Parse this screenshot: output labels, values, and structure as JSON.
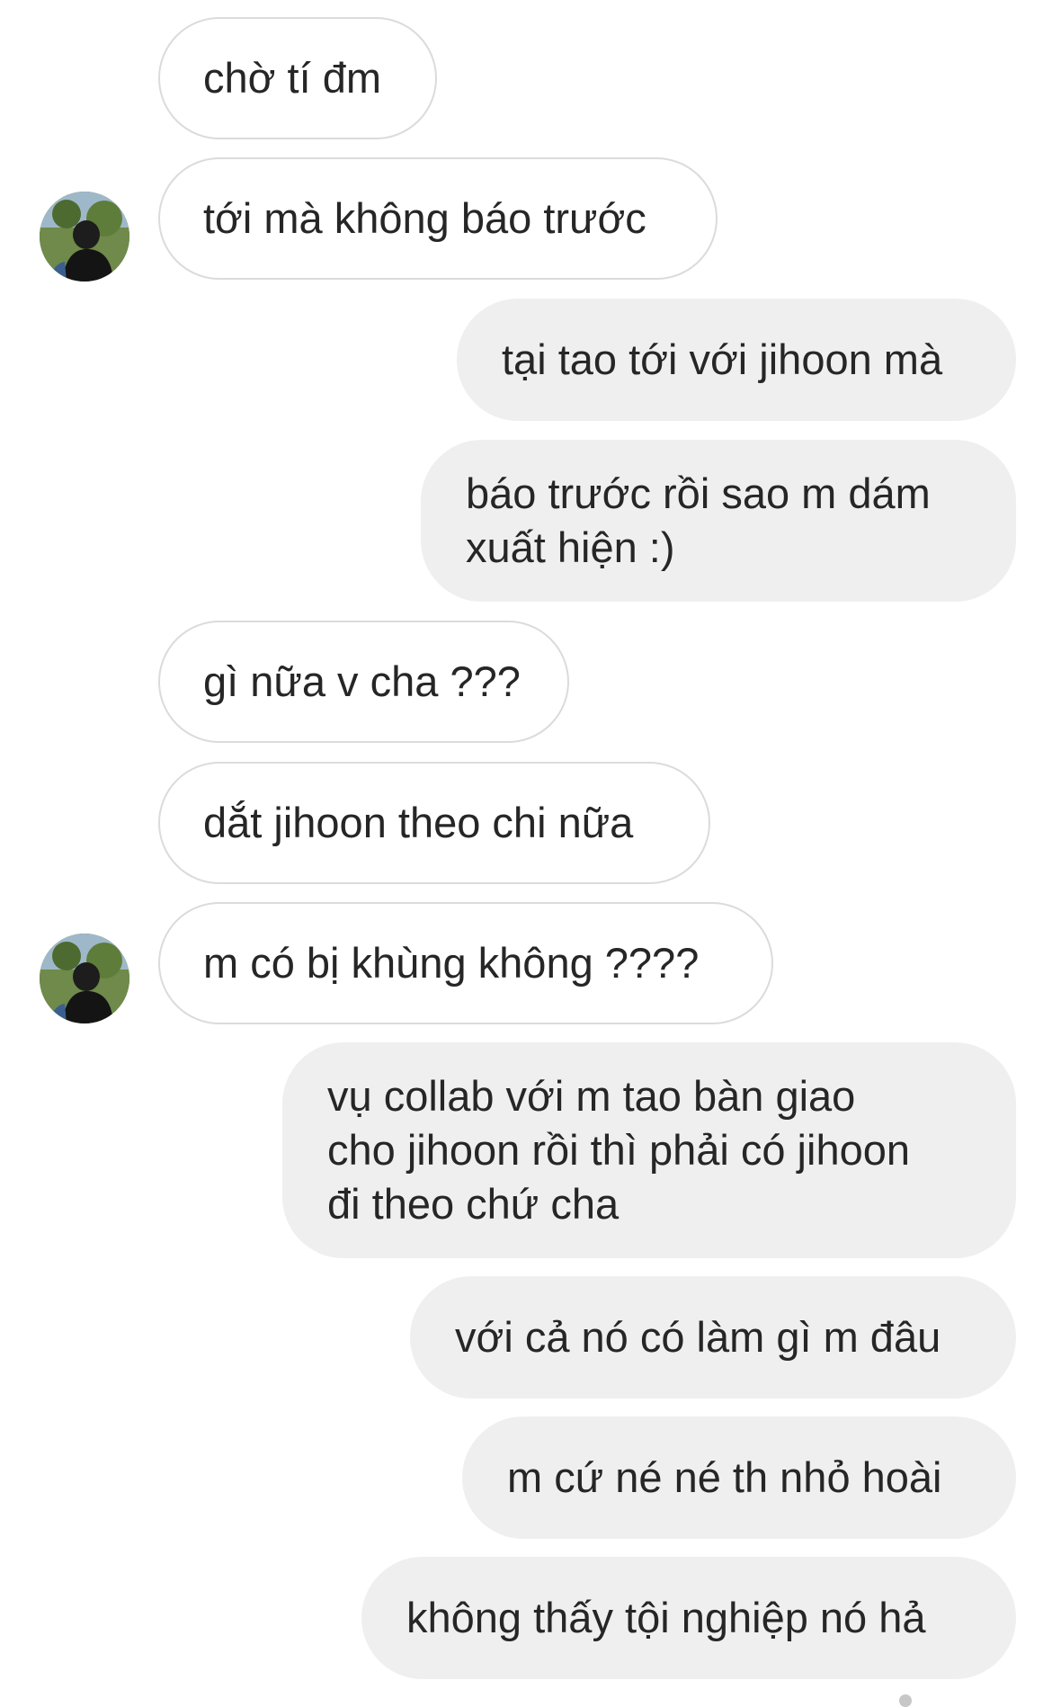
{
  "conversation": {
    "messages": [
      {
        "sender": "other",
        "text": "chờ tí đm"
      },
      {
        "sender": "other",
        "text": "tới mà không báo trước"
      },
      {
        "sender": "me",
        "text": "tại tao tới với jihoon mà"
      },
      {
        "sender": "me",
        "text": "báo trước rồi sao m dám\nxuất hiện :)"
      },
      {
        "sender": "other",
        "text": "gì nữa v cha ???"
      },
      {
        "sender": "other",
        "text": "dắt jihoon theo chi nữa"
      },
      {
        "sender": "other",
        "text": "m có bị khùng không ????"
      },
      {
        "sender": "me",
        "text": "vụ collab với m tao bàn giao\ncho jihoon rồi thì phải có jihoon\nđi theo chứ cha"
      },
      {
        "sender": "me",
        "text": "với cả nó có làm gì m đâu"
      },
      {
        "sender": "me",
        "text": "m cứ né né th nhỏ hoài"
      },
      {
        "sender": "me",
        "text": "không thấy tội nghiệp nó hả"
      }
    ]
  },
  "colors": {
    "incoming_bubble_bg": "#ffffff",
    "incoming_bubble_border": "#dbdbdb",
    "outgoing_bubble_bg": "#efefef",
    "text": "#262626"
  },
  "icons": {
    "avatar": "profile-photo-avatar"
  }
}
